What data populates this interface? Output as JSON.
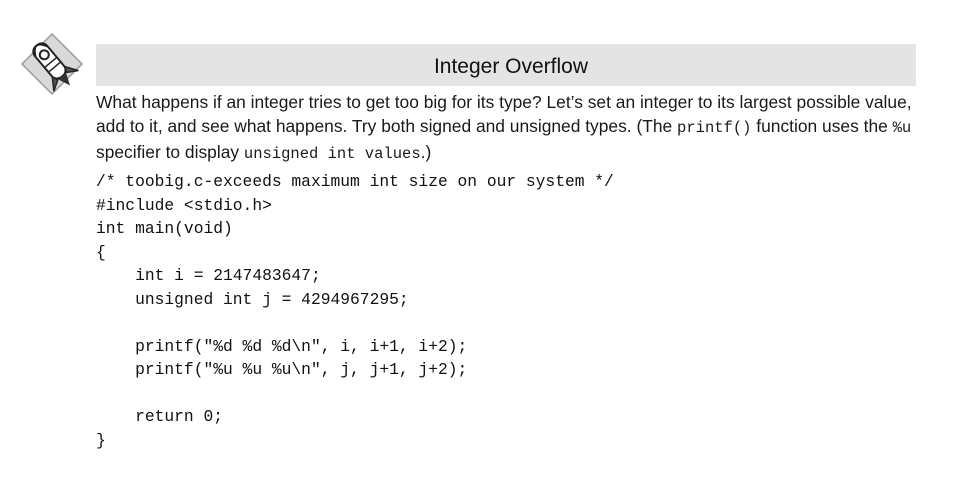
{
  "section": {
    "title": "Integer Overflow"
  },
  "intro": {
    "part1": "What happens if an integer tries to get too big for its type? Let’s set an integer to its largest possible value, add to it, and see what happens. Try both signed and unsigned types. (The ",
    "code1": "printf()",
    "part2": " function uses the ",
    "code2": "%u",
    "part3": " specifier to display ",
    "code3": "unsigned int values",
    "part4": ".)"
  },
  "code_lines": [
    "/* toobig.c-exceeds maximum int size on our system */",
    "#include <stdio.h>",
    "int main(void)",
    "{",
    "    int i = 2147483647;",
    "    unsigned int j = 4294967295;",
    "",
    "    printf(\"%d %d %d\\n\", i, i+1, i+2);",
    "    printf(\"%u %u %u\\n\", j, j+1, j+2);",
    "",
    "    return 0;",
    "}"
  ],
  "icons": {
    "logo": "rocket-logo-icon"
  }
}
